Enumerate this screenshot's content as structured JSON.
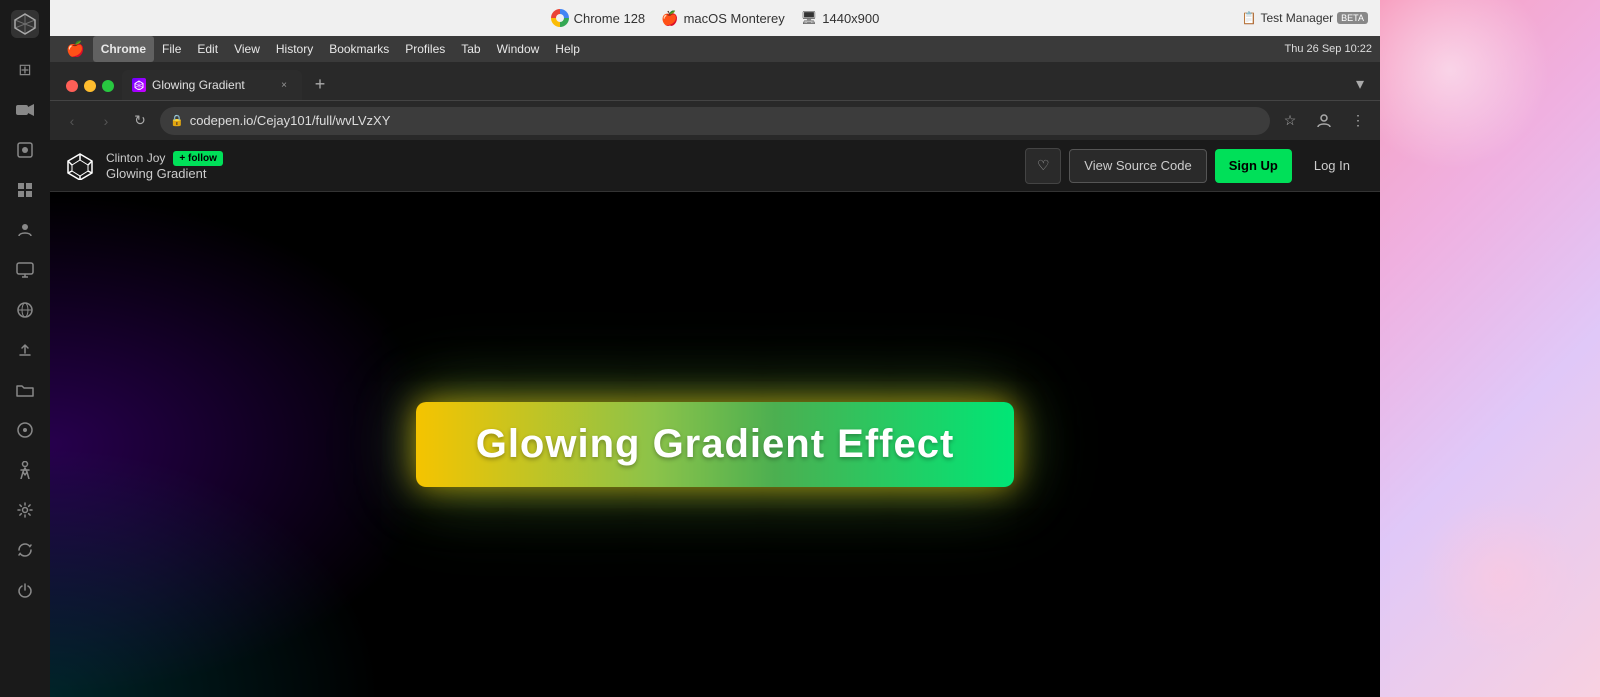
{
  "os_topbar": {
    "chrome_label": "Chrome 128",
    "macos_label": "macOS Monterey",
    "resolution_label": "1440x900",
    "datetime": "Thu 26 Sep  10:22",
    "test_manager_label": "Test Manager",
    "beta_label": "BETA"
  },
  "mac_menubar": {
    "items": [
      {
        "id": "apple",
        "label": "🍎"
      },
      {
        "id": "chrome",
        "label": "Chrome",
        "active": true
      },
      {
        "id": "file",
        "label": "File"
      },
      {
        "id": "edit",
        "label": "Edit"
      },
      {
        "id": "view",
        "label": "View"
      },
      {
        "id": "history",
        "label": "History"
      },
      {
        "id": "bookmarks",
        "label": "Bookmarks"
      },
      {
        "id": "profiles",
        "label": "Profiles"
      },
      {
        "id": "tab",
        "label": "Tab"
      },
      {
        "id": "window",
        "label": "Window"
      },
      {
        "id": "help",
        "label": "Help"
      }
    ],
    "right_info": "Thu 26 Sep  10:22"
  },
  "browser": {
    "tab": {
      "favicon_text": "✦",
      "title": "Glowing Gradient",
      "close_icon": "×"
    },
    "new_tab_icon": "+",
    "nav": {
      "back_icon": "‹",
      "forward_icon": "›",
      "reload_icon": "↻"
    },
    "address": {
      "url": "codepen.io/Cejay101/full/wvLVzXY",
      "lock_icon": "🔒"
    },
    "addr_right": {
      "bookmark_icon": "☆",
      "profile_icon": "○",
      "menu_icon": "⋮"
    }
  },
  "codepen": {
    "logo_initials": "CP",
    "author_name": "Clinton Joy",
    "follow_label": "+ follow",
    "pen_title": "Glowing Gradient",
    "heart_icon": "♡",
    "view_source_label": "View Source Code",
    "signup_label": "Sign Up",
    "login_label": "Log In"
  },
  "content": {
    "glowing_text": "Glowing Gradient Effect"
  },
  "sidebar": {
    "icons": [
      {
        "id": "logo",
        "symbol": "◈",
        "is_logo": true
      },
      {
        "id": "dashboard",
        "symbol": "⊞"
      },
      {
        "id": "camera",
        "symbol": "⬛"
      },
      {
        "id": "video",
        "symbol": "▶"
      },
      {
        "id": "grid",
        "symbol": "⊞"
      },
      {
        "id": "person",
        "symbol": "👤"
      },
      {
        "id": "monitor",
        "symbol": "🖥"
      },
      {
        "id": "globe",
        "symbol": "🌐"
      },
      {
        "id": "upload",
        "symbol": "⬆"
      },
      {
        "id": "folder",
        "symbol": "📁"
      },
      {
        "id": "tag",
        "symbol": "🏷"
      },
      {
        "id": "figure",
        "symbol": "🚶"
      },
      {
        "id": "settings",
        "symbol": "⚙"
      },
      {
        "id": "refresh",
        "symbol": "↺"
      },
      {
        "id": "power",
        "symbol": "⏻"
      }
    ]
  }
}
